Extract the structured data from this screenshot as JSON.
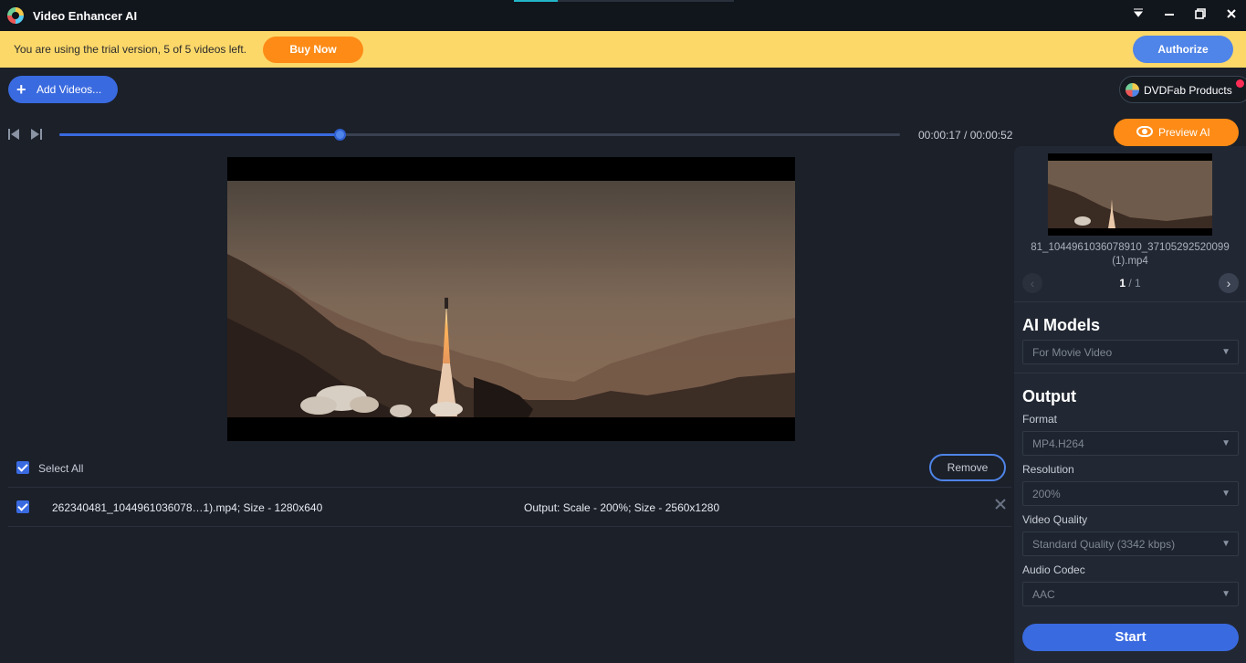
{
  "app": {
    "title": "Video Enhancer AI"
  },
  "window": {
    "menu_icon": "dropdown-arrow-icon",
    "minimize_icon": "minimize-icon",
    "restore_icon": "restore-icon",
    "close_icon": "close-icon"
  },
  "trial": {
    "message": "You are using the trial version, 5 of 5 videos left.",
    "buy_label": "Buy Now",
    "authorize_label": "Authorize"
  },
  "toolbar": {
    "add_videos_label": "Add Videos...",
    "dvdfab_label": "DVDFab Products"
  },
  "player": {
    "current_time": "00:00:17",
    "total_time": "00:00:52",
    "time_display": "00:00:17 / 00:00:52",
    "progress": 0.3333,
    "preview_label": "Preview AI"
  },
  "list": {
    "select_all_label": "Select All",
    "remove_label": "Remove",
    "rows": [
      {
        "name": "262340481_1044961036078…1).mp4; Size - 1280x640",
        "output": "Output: Scale - 200%; Size - 2560x1280",
        "checked": true
      }
    ]
  },
  "side": {
    "file_name_line1": "81_1044961036078910_37105292520099",
    "file_name_line2": "(1).mp4",
    "page_current": "1",
    "page_total": "/ 1",
    "ai_models_title": "AI Models",
    "ai_model_value": "For Movie Video",
    "output_title": "Output",
    "format_label": "Format",
    "format_value": "MP4.H264",
    "resolution_label": "Resolution",
    "resolution_value": "200%",
    "quality_label": "Video Quality",
    "quality_value": "Standard Quality (3342 kbps)",
    "codec_label": "Audio Codec",
    "codec_value": "AAC",
    "start_label": "Start"
  },
  "colors": {
    "accent": "#3a6ae0",
    "orange": "#fd8b16",
    "trial_bg": "#fcd869"
  }
}
